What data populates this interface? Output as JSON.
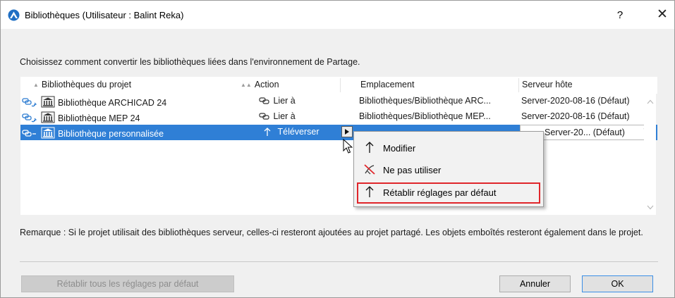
{
  "window": {
    "title": "Bibliothèques (Utilisateur : Balint Reka)",
    "help_label": "?",
    "close_label": "✕"
  },
  "instruction": "Choisissez comment convertir les bibliothèques liées dans l'environnement de Partage.",
  "table": {
    "columns": {
      "library": "Bibliothèques du projet",
      "action": "Action",
      "location": "Emplacement",
      "host": "Serveur hôte"
    },
    "rows": [
      {
        "name": "Bibliothèque ARCHICAD 24",
        "action": "Lier à",
        "location": "Bibliothèques/Bibliothèque ARC...",
        "host": "Server-2020-08-16 (Défaut)"
      },
      {
        "name": "Bibliothèque MEP 24",
        "action": "Lier à",
        "location": "Bibliothèques/Bibliothèque MEP...",
        "host": "Server-2020-08-16 (Défaut)"
      },
      {
        "name": "Bibliothèque personnalisée",
        "action": "Téléverser",
        "location": "",
        "host": "Server-20... (Défaut)",
        "selected": true
      }
    ]
  },
  "context_menu": {
    "items": [
      {
        "label": "Modifier",
        "icon": "up-arrow-icon"
      },
      {
        "label": "Ne pas utiliser",
        "icon": "no-use-icon"
      },
      {
        "label": "Rétablir réglages par défaut",
        "icon": "up-arrow-icon",
        "highlighted": true
      }
    ]
  },
  "remark": "Remarque : Si le projet utilisait des bibliothèques serveur, celles-ci resteront ajoutées au projet partagé. Les objets emboîtés resteront également dans le projet.",
  "buttons": {
    "reset_all": "Rétablir tous les réglages par défaut",
    "cancel": "Annuler",
    "ok": "OK"
  },
  "colors": {
    "selection": "#2f7fd6",
    "highlight_border": "#e0262b",
    "default_button_border": "#3a8ee6"
  }
}
